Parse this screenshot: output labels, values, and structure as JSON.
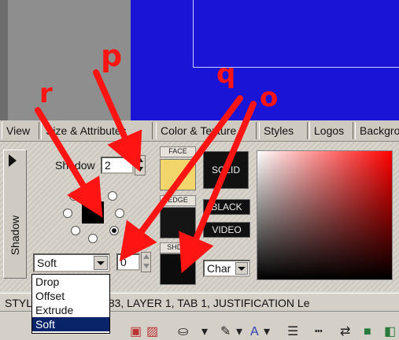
{
  "tabs": [
    "View",
    "Size & Attributes",
    "Color & Texture",
    "Styles",
    "Logos",
    "Backgro"
  ],
  "side_panel_label": "Shadow",
  "shadow": {
    "label": "Shadow",
    "value": "2"
  },
  "style_select": {
    "value": "Soft",
    "options": [
      "Drop",
      "Offset",
      "Extrude",
      "Soft"
    ],
    "selected": "Soft"
  },
  "offset_field": {
    "value": "0"
  },
  "swatches": {
    "face_label": "FACE",
    "edge_label": "EDGE",
    "shadow_label": "SHDW",
    "face_color": "#f2d66b",
    "edge_color": "#151515",
    "shadow_color": "#0c0c0c"
  },
  "buttons": {
    "solid": "SOLID",
    "black": "BLACK",
    "video": "VIDEO"
  },
  "char_select": {
    "value": "Char"
  },
  "status_text": "STYL  ​(219), BASE: 283, LAYER 1, TAB 1, JUSTIFICATION Le",
  "annotations": [
    "r",
    "p",
    "q",
    "o"
  ],
  "colors": {
    "preview_blue": "#1a14d6",
    "arrow_red": "#ff1414",
    "selection_blue": "#0a246a"
  }
}
